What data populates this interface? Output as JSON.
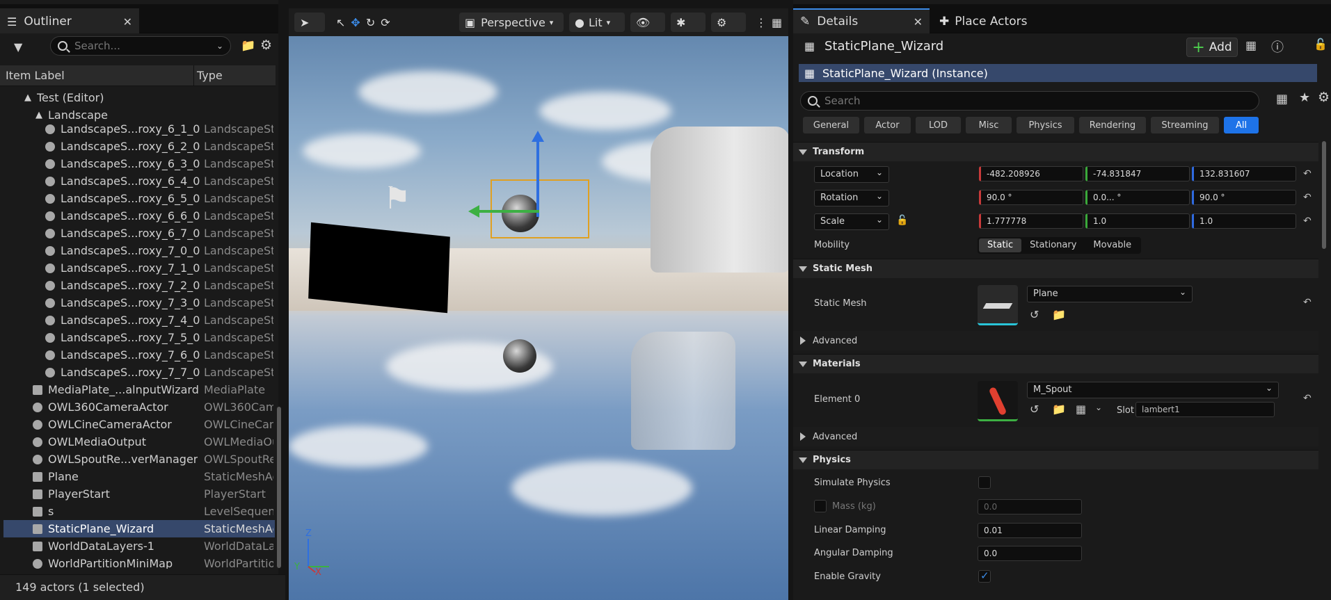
{
  "outliner": {
    "tab_title": "Outliner",
    "search_placeholder": "Search...",
    "col_label": "Item Label",
    "col_type": "Type",
    "rows": [
      {
        "name": "Test (Editor)",
        "type": ""
      },
      {
        "name": "Landscape",
        "type": ""
      },
      {
        "name": "LandscapeS...roxy_6_1_0",
        "type": "LandscapeSt"
      },
      {
        "name": "LandscapeS...roxy_6_2_0",
        "type": "LandscapeSt"
      },
      {
        "name": "LandscapeS...roxy_6_3_0",
        "type": "LandscapeSt"
      },
      {
        "name": "LandscapeS...roxy_6_4_0",
        "type": "LandscapeSt"
      },
      {
        "name": "LandscapeS...roxy_6_5_0",
        "type": "LandscapeSt"
      },
      {
        "name": "LandscapeS...roxy_6_6_0",
        "type": "LandscapeSt"
      },
      {
        "name": "LandscapeS...roxy_6_7_0",
        "type": "LandscapeSt"
      },
      {
        "name": "LandscapeS...roxy_7_0_0",
        "type": "LandscapeSt"
      },
      {
        "name": "LandscapeS...roxy_7_1_0",
        "type": "LandscapeSt"
      },
      {
        "name": "LandscapeS...roxy_7_2_0",
        "type": "LandscapeSt"
      },
      {
        "name": "LandscapeS...roxy_7_3_0",
        "type": "LandscapeSt"
      },
      {
        "name": "LandscapeS...roxy_7_4_0",
        "type": "LandscapeSt"
      },
      {
        "name": "LandscapeS...roxy_7_5_0",
        "type": "LandscapeSt"
      },
      {
        "name": "LandscapeS...roxy_7_6_0",
        "type": "LandscapeSt"
      },
      {
        "name": "LandscapeS...roxy_7_7_0",
        "type": "LandscapeSt"
      },
      {
        "name": "MediaPlate_...alnputWizard",
        "type": "MediaPlate"
      },
      {
        "name": "OWL360CameraActor",
        "type": "OWL360Cam"
      },
      {
        "name": "OWLCineCameraActor",
        "type": "OWLCineCam"
      },
      {
        "name": "OWLMediaOutput",
        "type": "OWLMediaOu"
      },
      {
        "name": "OWLSpoutRe...verManager",
        "type": "OWLSpoutRe"
      },
      {
        "name": "Plane",
        "type": "StaticMeshAc"
      },
      {
        "name": "PlayerStart",
        "type": "PlayerStart"
      },
      {
        "name": "s",
        "type": "LevelSequenc"
      },
      {
        "name": "StaticPlane_Wizard",
        "type": "StaticMeshAc"
      },
      {
        "name": "WorldDataLayers-1",
        "type": "WorldDataLay"
      },
      {
        "name": "WorldPartitionMiniMap",
        "type": "WorldPartitio"
      }
    ],
    "status": "149 actors (1 selected)"
  },
  "viewport": {
    "perspective_label": "Perspective",
    "lit_label": "Lit",
    "axis_z": "Z",
    "axis_y": "Y",
    "axis_x": "X"
  },
  "details": {
    "tab_title": "Details",
    "place_actors_tab": "Place Actors",
    "actor_name": "StaticPlane_Wizard",
    "add_label": "Add",
    "instance_label": "StaticPlane_Wizard (Instance)",
    "search_placeholder": "Search",
    "categories": [
      "General",
      "Actor",
      "LOD",
      "Misc",
      "Physics",
      "Rendering",
      "Streaming",
      "All"
    ],
    "transform": {
      "header": "Transform",
      "location_label": "Location",
      "location": [
        "-482.208926",
        "-74.831847",
        "132.831607"
      ],
      "rotation_label": "Rotation",
      "rotation": [
        "90.0 °",
        "0.0... °",
        "90.0 °"
      ],
      "scale_label": "Scale",
      "scale": [
        "1.777778",
        "1.0",
        "1.0"
      ],
      "mobility_label": "Mobility",
      "mobility_options": [
        "Static",
        "Stationary",
        "Movable"
      ]
    },
    "static_mesh": {
      "header": "Static Mesh",
      "label": "Static Mesh",
      "value": "Plane",
      "advanced": "Advanced"
    },
    "materials": {
      "header": "Materials",
      "element_label": "Element 0",
      "value": "M_Spout",
      "slot_label": "Slot",
      "slot_value": "lambert1",
      "advanced": "Advanced"
    },
    "physics": {
      "header": "Physics",
      "simulate_label": "Simulate Physics",
      "mass_label": "Mass (kg)",
      "mass_value": "0.0",
      "linear_label": "Linear Damping",
      "linear_value": "0.01",
      "angular_label": "Angular Damping",
      "angular_value": "0.0",
      "gravity_label": "Enable Gravity"
    }
  }
}
